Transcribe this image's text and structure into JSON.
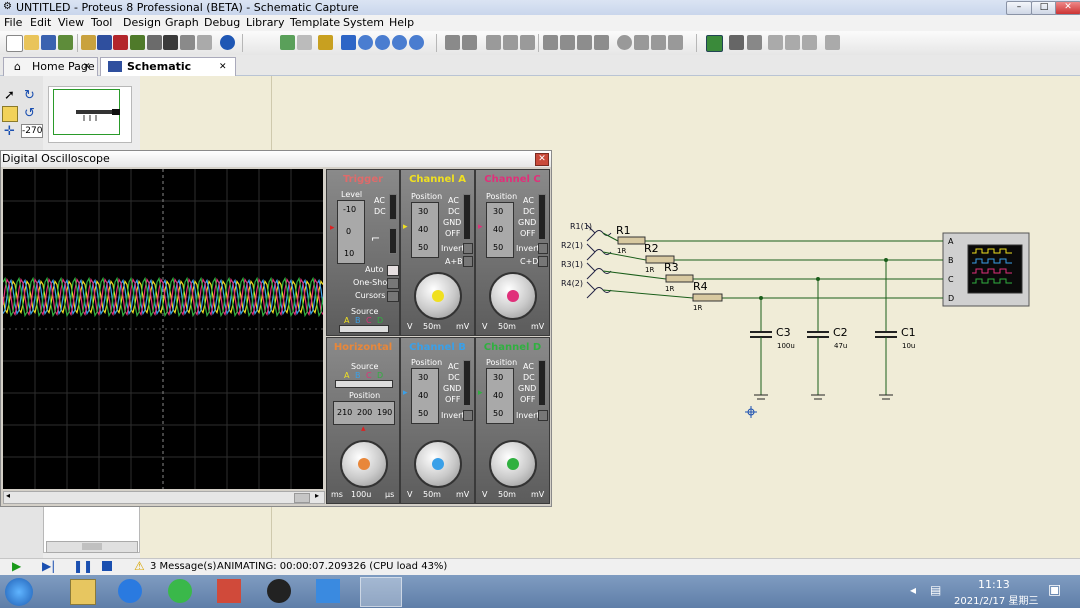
{
  "window": {
    "title": "UNTITLED - Proteus 8 Professional (BETA) - Schematic Capture",
    "min": "–",
    "max": "□",
    "close": "✕"
  },
  "menu": [
    "File",
    "Edit",
    "View",
    "Tool",
    "Design",
    "Graph",
    "Debug",
    "Library",
    "Template",
    "System",
    "Help"
  ],
  "tabs": [
    {
      "label": "Home Page",
      "close": "✕"
    },
    {
      "label": "Schematic Capture",
      "close": "✕"
    }
  ],
  "left_tools": {
    "rotation": "-270"
  },
  "scope": {
    "title": "Digital Oscilloscope",
    "trigger": {
      "label": "Trigger",
      "level_label": "Level",
      "level_vals": [
        "-10",
        "0",
        "10"
      ],
      "ac": "AC",
      "dc": "DC",
      "auto": "Auto",
      "oneshot": "One-Shot",
      "cursors": "Cursors",
      "source": "Source",
      "sources": [
        "A",
        "B",
        "C",
        "D"
      ]
    },
    "channel_a": {
      "label": "Channel A",
      "color": "#f0e020",
      "position": "Position",
      "vals": [
        "30",
        "40",
        "50"
      ],
      "ac": "AC",
      "dc": "DC",
      "gnd": "GND",
      "off": "OFF",
      "invert": "Invert",
      "combine": "A+B",
      "v": "V",
      "scale": "50m",
      "mv": "mV"
    },
    "channel_c": {
      "label": "Channel C",
      "color": "#e0307a",
      "position": "Position",
      "vals": [
        "30",
        "40",
        "50"
      ],
      "ac": "AC",
      "dc": "DC",
      "gnd": "GND",
      "off": "OFF",
      "invert": "Invert",
      "combine": "C+D",
      "v": "V",
      "scale": "50m",
      "mv": "mV"
    },
    "horizontal": {
      "label": "Horizontal",
      "source": "Source",
      "sources": [
        "A",
        "B",
        "C",
        "D"
      ],
      "position": "Position",
      "pos_vals": [
        "210",
        "200",
        "190"
      ],
      "ms": "ms",
      "scale": "100u",
      "us": "µs"
    },
    "channel_b": {
      "label": "Channel B",
      "color": "#3aa0e8",
      "position": "Position",
      "vals": [
        "30",
        "40",
        "50"
      ],
      "ac": "AC",
      "dc": "DC",
      "gnd": "GND",
      "off": "OFF",
      "invert": "Invert",
      "v": "V",
      "scale": "50m",
      "mv": "mV"
    },
    "channel_d": {
      "label": "Channel D",
      "color": "#30b040",
      "position": "Position",
      "vals": [
        "30",
        "40",
        "50"
      ],
      "ac": "AC",
      "dc": "DC",
      "gnd": "GND",
      "off": "OFF",
      "invert": "Invert",
      "v": "V",
      "scale": "50m",
      "mv": "mV"
    },
    "trace_colors": [
      "#f0e020",
      "#3aa0e8",
      "#e0307a",
      "#30b040"
    ]
  },
  "schematic": {
    "sources": [
      "R1(1)",
      "R2(1)",
      "R3(1)",
      "R4(2)"
    ],
    "resistors": [
      {
        "name": "R1",
        "value": "1R"
      },
      {
        "name": "R2",
        "value": "1R"
      },
      {
        "name": "R3",
        "value": "1R"
      },
      {
        "name": "R4",
        "value": "1R"
      }
    ],
    "capacitors": [
      {
        "name": "C3",
        "value": "100u"
      },
      {
        "name": "C2",
        "value": "47u"
      },
      {
        "name": "C1",
        "value": "10u"
      }
    ],
    "scope_pins": [
      "A",
      "B",
      "C",
      "D"
    ]
  },
  "status": {
    "messages": "3 Message(s)",
    "animating": "ANIMATING: 00:00:07.209326 (CPU load 43%)"
  },
  "taskbar": {
    "time": "11:13",
    "date": "2021/2/17 星期三"
  }
}
